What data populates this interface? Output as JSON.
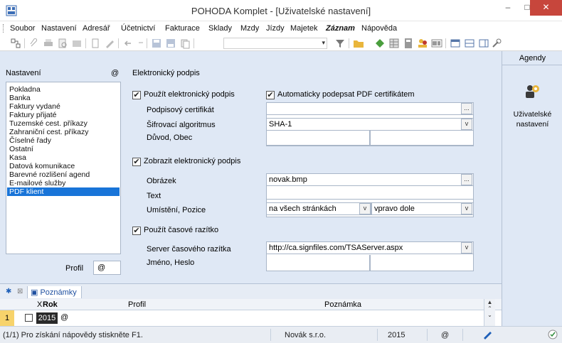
{
  "window": {
    "title": "POHODA Komplet - [Uživatelské nastavení]",
    "min_label": "–",
    "max_label": "□",
    "close_label": "✕"
  },
  "menu": [
    "Soubor",
    "Nastavení",
    "Adresář",
    "Účetnictví",
    "Fakturace",
    "Sklady",
    "Mzdy",
    "Jízdy",
    "Majetek",
    "Záznam",
    "Nápověda"
  ],
  "left": {
    "header": "Nastavení",
    "header_at": "@",
    "items": [
      "Pokladna",
      "Banka",
      "Faktury vydané",
      "Faktury přijaté",
      "Tuzemské cest. příkazy",
      "Zahraniční cest. příkazy",
      "Číselné řady",
      "Ostatní",
      "Kasa",
      "Datová komunikace",
      "Barevné rozlišení agend",
      "E-mailové služby",
      "PDF klient"
    ],
    "selected_index": 12,
    "profil_label": "Profil",
    "profil_value": "@"
  },
  "form": {
    "section_title": "Elektronický podpis",
    "use_sig_label": "Použít elektronický podpis",
    "use_sig_checked": "✔",
    "auto_sign_label": "Automaticky podepsat PDF certifikátem",
    "auto_sign_checked": "✔",
    "cert_label": "Podpisový certifikát",
    "cert_value": "",
    "algo_label": "Šifrovací algoritmus",
    "algo_value": "SHA-1",
    "reason_label": "Důvod, Obec",
    "show_sig_label": "Zobrazit elektronický podpis",
    "show_sig_checked": "✔",
    "image_label": "Obrázek",
    "image_value": "novak.bmp",
    "text_label": "Text",
    "placement_label": "Umístění, Pozice",
    "placement_value": "na všech stránkách",
    "position_value": "vpravo dole",
    "use_ts_label": "Použít časové razítko",
    "use_ts_checked": "✔",
    "ts_server_label": "Server časového razítka",
    "ts_server_value": "http://ca.signfiles.com/TSAServer.aspx",
    "name_pass_label": "Jméno, Heslo",
    "browse_label": "...",
    "dropdown_label": "v"
  },
  "agendy": {
    "title": "Agendy",
    "item_label_1": "Uživatelské",
    "item_label_2": "nastavení"
  },
  "bottom": {
    "star": "✱",
    "filter": "⊠",
    "tab_label": "Poznámky",
    "columns": {
      "x": "X",
      "rok": "Rok",
      "profil": "Profil",
      "poznamka": "Poznámka"
    },
    "row": {
      "num": "1",
      "year": "2015",
      "at": "@"
    }
  },
  "status": {
    "help": "(1/1) Pro získání nápovědy stiskněte F1.",
    "company": "Novák s.r.o.",
    "year": "2015",
    "at": "@"
  },
  "colors": {
    "panel_bg": "#dfe8f5",
    "selection": "#1874d8",
    "close_btn": "#c7463c"
  }
}
